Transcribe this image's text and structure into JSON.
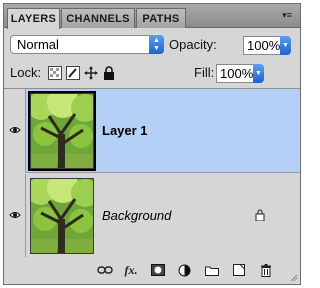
{
  "tabs": [
    {
      "label": "LAYERS",
      "active": true
    },
    {
      "label": "CHANNELS",
      "active": false
    },
    {
      "label": "PATHS",
      "active": false
    }
  ],
  "panel_menu_icon": "panel-menu-icon",
  "blend_mode": "Normal",
  "opacity": {
    "label": "Opacity:",
    "value": "100%"
  },
  "lock": {
    "label": "Lock:"
  },
  "fill": {
    "label": "Fill:",
    "value": "100%"
  },
  "layers": [
    {
      "name": "Layer 1",
      "selected": true,
      "visible": true,
      "locked": false
    },
    {
      "name": "Background",
      "selected": false,
      "visible": true,
      "locked": true
    }
  ],
  "footer_icons": [
    "link-layers-icon",
    "fx-icon",
    "layer-mask-icon",
    "adjustment-layer-icon",
    "group-folder-icon",
    "new-layer-icon",
    "trash-icon"
  ],
  "colors": {
    "selection": "#b5d0f6",
    "panel": "#d6d6d6",
    "accent": "#1c64d6"
  }
}
